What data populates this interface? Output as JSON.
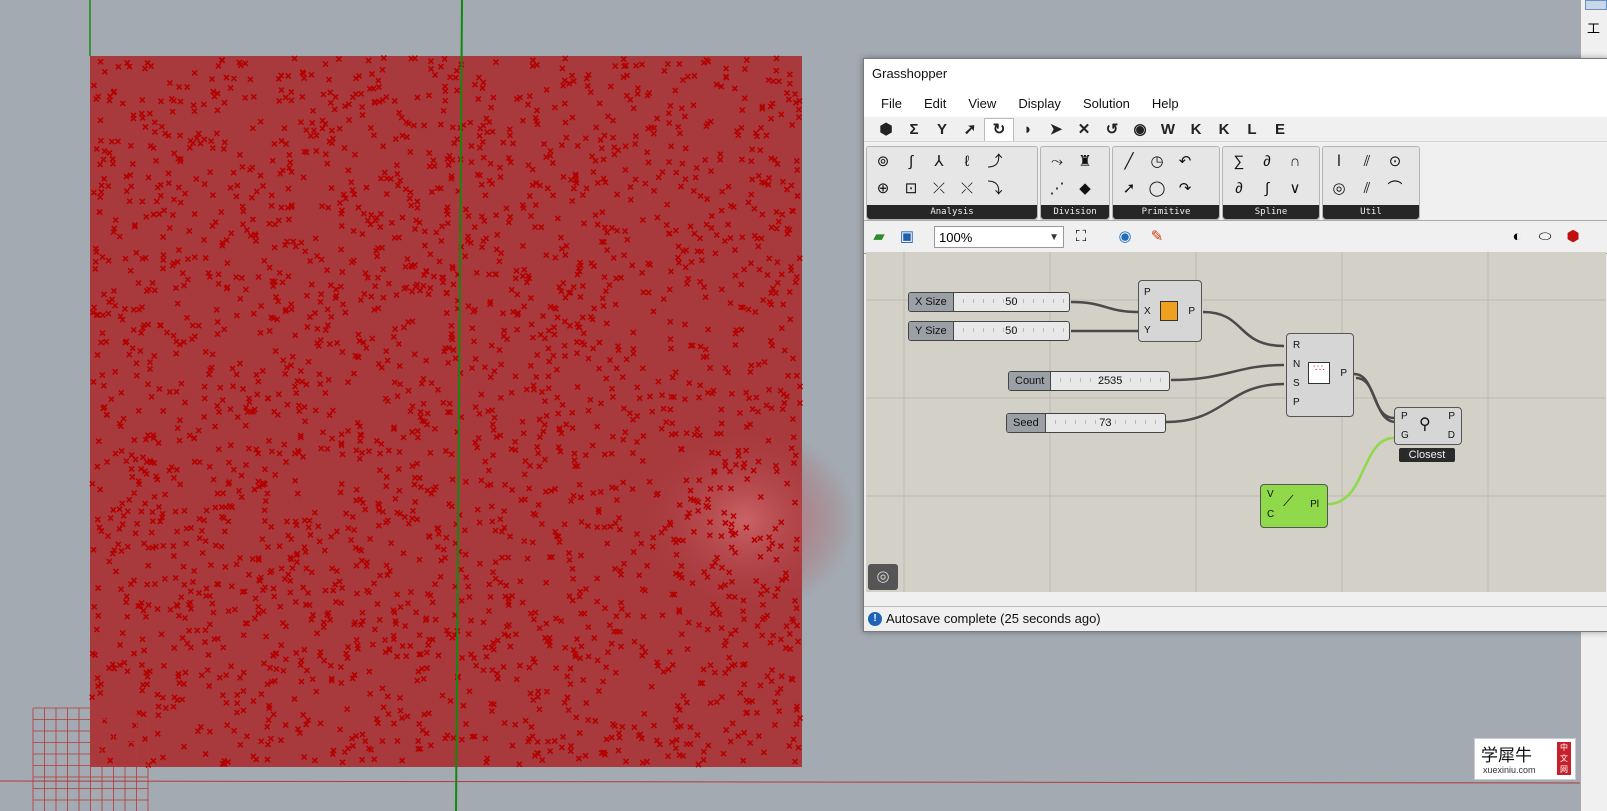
{
  "grasshopper": {
    "title": "Grasshopper",
    "menu": [
      "File",
      "Edit",
      "View",
      "Display",
      "Solution",
      "Help"
    ],
    "tabs": [
      {
        "glyph": "⬢",
        "icon": "params-tab-icon"
      },
      {
        "glyph": "Σ",
        "icon": "maths-tab-icon"
      },
      {
        "glyph": "Y",
        "icon": "sets-tab-icon"
      },
      {
        "glyph": "➚",
        "icon": "vector-tab-icon"
      },
      {
        "glyph": "↻",
        "icon": "curve-tab-icon",
        "active": true
      },
      {
        "glyph": "◗",
        "icon": "surface-tab-icon"
      },
      {
        "glyph": "➤",
        "icon": "mesh-tab-icon"
      },
      {
        "glyph": "✕",
        "icon": "intersect-tab-icon"
      },
      {
        "glyph": "↺",
        "icon": "transform-tab-icon"
      },
      {
        "glyph": "◉",
        "icon": "display-tab-icon"
      },
      {
        "glyph": "W",
        "icon": "w-tab"
      },
      {
        "glyph": "K",
        "icon": "k-tab-1"
      },
      {
        "glyph": "K",
        "icon": "k-tab-2"
      },
      {
        "glyph": "L",
        "icon": "l-tab"
      },
      {
        "glyph": "E",
        "icon": "e-tab"
      }
    ],
    "panels": [
      {
        "label": "Analysis",
        "icons": [
          "⊚",
          "∫",
          "⅄",
          "ℓ",
          "⤴",
          "⊕",
          "⊡",
          "⤫",
          "⤬",
          "⤵"
        ]
      },
      {
        "label": "Division",
        "icons": [
          "⤳",
          "♜",
          "⋰",
          "◆"
        ]
      },
      {
        "label": "Primitive",
        "icons": [
          "╱",
          "◷",
          "↶",
          "➚",
          "◯",
          "↷"
        ]
      },
      {
        "label": "Spline",
        "icons": [
          "∑",
          "∂",
          "∩",
          "∂",
          "∫",
          "∨"
        ]
      },
      {
        "label": "Util",
        "icons": [
          "ⅼ",
          "⫽",
          "⊙",
          "◎",
          "⫽",
          "⌒"
        ]
      }
    ],
    "zoom": "100%",
    "status": "Autosave complete (25 seconds ago)",
    "components": {
      "xsize": {
        "name": "X Size",
        "value": "50"
      },
      "ysize": {
        "name": "Y Size",
        "value": "50"
      },
      "count": {
        "name": "Count",
        "value": "2535"
      },
      "seed": {
        "name": "Seed",
        "value": "73"
      },
      "rect": {
        "inputs": [
          "P",
          "X",
          "Y"
        ],
        "outputs": [
          "P"
        ]
      },
      "populate": {
        "inputs": [
          "R",
          "N",
          "S",
          "P"
        ],
        "outputs": [
          "P"
        ]
      },
      "closest": {
        "inputs": [
          "P",
          "G"
        ],
        "outputs": [
          "P",
          "D"
        ],
        "label": "Closest"
      },
      "plane": {
        "inputs": [
          "V",
          "C"
        ],
        "outputs": [
          "Pl"
        ]
      }
    }
  },
  "right_strip": {
    "chars": [
      "工"
    ]
  },
  "logo": {
    "cn": "学犀牛",
    "en": "xuexiniu.com",
    "seal": "中文网"
  },
  "colors": {
    "viewport_bg": "#a3aab2",
    "point_fill": "#a83a3e",
    "point_mark": "#b50000",
    "green_axis": "#0f8a0f",
    "red_axis": "#b23a3a",
    "canvas_bg": "#d3d0c8",
    "green_component": "#8fd94a"
  }
}
